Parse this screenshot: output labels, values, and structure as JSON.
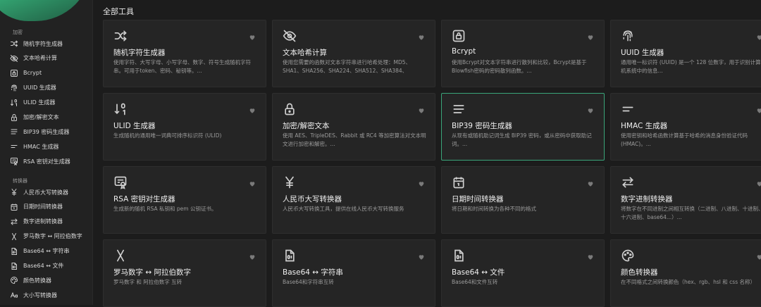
{
  "sidebar": {
    "groups": [
      {
        "title": "加密",
        "items": [
          {
            "label": "随机字符生成器",
            "icon": "shuffle-icon"
          },
          {
            "label": "文本哈希计算",
            "icon": "eye-off-icon"
          },
          {
            "label": "Bcrypt",
            "icon": "lock-box-icon"
          },
          {
            "label": "UUID 生成器",
            "icon": "fingerprint-icon"
          },
          {
            "label": "ULID 生成器",
            "icon": "sort-numeric-icon"
          },
          {
            "label": "加密/解密文本",
            "icon": "lock-icon"
          },
          {
            "label": "BIP39 密码生成器",
            "icon": "align-lines-icon"
          },
          {
            "label": "HMAC 生成器",
            "icon": "short-lines-icon"
          },
          {
            "label": "RSA 密钥对生成器",
            "icon": "certificate-icon"
          }
        ]
      },
      {
        "title": "转换器",
        "items": [
          {
            "label": "人民币大写转换器",
            "icon": "yen-icon"
          },
          {
            "label": "日期时间转换器",
            "icon": "calendar-icon"
          },
          {
            "label": "数字进制转换器",
            "icon": "arrows-exchange-icon"
          },
          {
            "label": "罗马数字 ↔ 阿拉伯数字",
            "icon": "letter-x-icon"
          },
          {
            "label": "Base64 ↔ 字符串",
            "icon": "file-digit-icon"
          },
          {
            "label": "Base64 ↔ 文件",
            "icon": "file-digit-icon"
          },
          {
            "label": "颜色转换器",
            "icon": "palette-icon"
          },
          {
            "label": "大小写转换器",
            "icon": "letter-case-icon"
          }
        ]
      }
    ]
  },
  "main": {
    "section_title": "全部工具",
    "cards": [
      {
        "title": "随机字符生成器",
        "desc": "使用字符、大写字母、小写字母、数字、符号生成随机字符串。可用于token、密码、秘钥等。...",
        "icon": "shuffle-icon",
        "favorite_icon": "heart-icon"
      },
      {
        "title": "文本哈希计算",
        "desc": "使用您需要的函数对文本字符串进行哈希处理：MD5、SHA1、SHA256、SHA224、SHA512、SHA384、SHA3...",
        "icon": "eye-off-icon",
        "favorite_icon": "heart-icon"
      },
      {
        "title": "Bcrypt",
        "desc": "使用Bcrypt对文本字符串进行散列和比较，Bcrypt是基于Blowfish密码的密码散列函数。...",
        "icon": "lock-box-icon",
        "favorite_icon": "heart-icon"
      },
      {
        "title": "UUID 生成器",
        "desc": "通用唯一标识符 (UUID) 是一个 128 位数字，用于识别计算机系统中的信息...",
        "icon": "fingerprint-icon",
        "favorite_icon": "heart-icon"
      },
      {
        "title": "ULID 生成器",
        "desc": "生成随机的通用唯一词典可排序标识符 (ULID)",
        "icon": "sort-numeric-icon",
        "favorite_icon": "heart-icon"
      },
      {
        "title": "加密/解密文本",
        "desc": "使用 AES、TripleDES、Rabbit 或 RC4 等加密算法对文本明文进行加密和解密。...",
        "icon": "lock-icon",
        "favorite_icon": "heart-icon"
      },
      {
        "title": "BIP39 密码生成器",
        "desc": "从现有或随机助记词生成 BIP39 密码，或从密码中获取助记词。...",
        "icon": "align-lines-icon",
        "favorite_icon": "heart-icon",
        "selected": true
      },
      {
        "title": "HMAC 生成器",
        "desc": "使用密钥和哈希函数计算基于哈希的消息身份验证代码 (HMAC)。...",
        "icon": "short-lines-icon",
        "favorite_icon": "heart-icon"
      },
      {
        "title": "RSA 密钥对生成器",
        "desc": "生成新的随机 RSA 私钥和 pem 公钥证书。",
        "icon": "certificate-icon",
        "favorite_icon": "heart-icon"
      },
      {
        "title": "人民币大写转换器",
        "desc": "人民币大写转换工具，提供在线人民币大写转换服务",
        "icon": "yen-icon",
        "favorite_icon": "heart-icon"
      },
      {
        "title": "日期时间转换器",
        "desc": "将日期和时间转换为各种不同的格式",
        "icon": "calendar-icon",
        "favorite_icon": "heart-icon"
      },
      {
        "title": "数字进制转换器",
        "desc": "将数字在不同进制之间相互转换（二进制、八进制、十进制、十六进制、base64...）...",
        "icon": "arrows-exchange-icon",
        "favorite_icon": "heart-icon"
      },
      {
        "title": "罗马数字 ↔ 阿拉伯数字",
        "desc": "罗马数字 和 阿拉伯数字 互转",
        "icon": "letter-x-icon",
        "favorite_icon": "heart-icon"
      },
      {
        "title": "Base64 ↔ 字符串",
        "desc": "Base64和字符串互转",
        "icon": "file-digit-icon",
        "favorite_icon": "heart-icon"
      },
      {
        "title": "Base64 ↔ 文件",
        "desc": "Base64和文件互转",
        "icon": "file-digit-icon",
        "favorite_icon": "heart-icon"
      },
      {
        "title": "颜色转换器",
        "desc": "在不同格式之间转换颜色（hex、rgb、hsl 和 css 名称）",
        "icon": "palette-icon",
        "favorite_icon": "heart-icon"
      }
    ]
  },
  "colors": {
    "background": "#1c1c1c",
    "sidebar": "#222222",
    "card": "#252525",
    "accent": "#3aa57a",
    "text": "#e6e6e6",
    "muted": "#9b9b9b"
  }
}
